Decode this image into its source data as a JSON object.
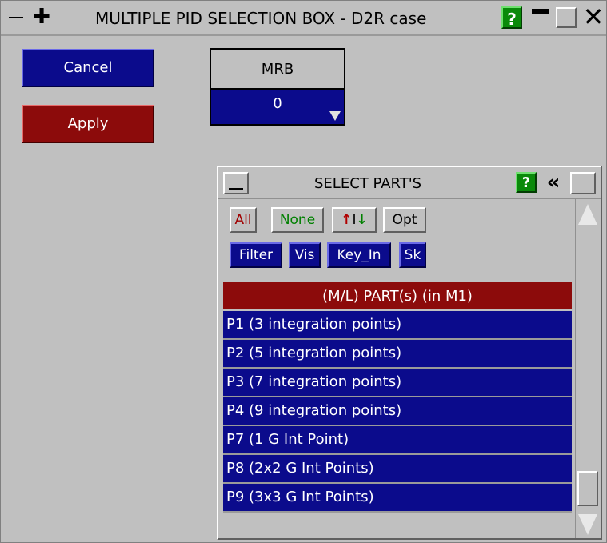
{
  "window": {
    "title": "MULTIPLE PID SELECTION BOX - D2R case",
    "help_label": "?"
  },
  "actions": {
    "cancel_label": "Cancel",
    "apply_label": "Apply"
  },
  "mrb": {
    "label": "MRB",
    "value": "0"
  },
  "select_panel": {
    "title": "SELECT PART'S",
    "help_label": "?",
    "collapse_glyph": "«",
    "buttons": {
      "all": "All",
      "none": "None",
      "sort_up": "↑",
      "sort_bar": "I",
      "sort_down": "↓",
      "opt": "Opt"
    },
    "filters": {
      "filter": "Filter",
      "vis": "Vis",
      "key_in": "Key_In",
      "sk": "Sk"
    },
    "list_header": "(M/L) PART(s) (in M1)",
    "parts": [
      "P1 (3 integration points)",
      "P2 (5 integration points)",
      "P3 (7 integration points)",
      "P4 (9 integration points)",
      "P7 (1 G Int Point)",
      "P8 (2x2 G Int Points)",
      "P9 (3x3 G Int Points)"
    ]
  },
  "colors": {
    "button_blue": "#0b0b8c",
    "button_red": "#8c0b0b",
    "help_green": "#0a8a0a",
    "background": "#c0c0c0"
  }
}
